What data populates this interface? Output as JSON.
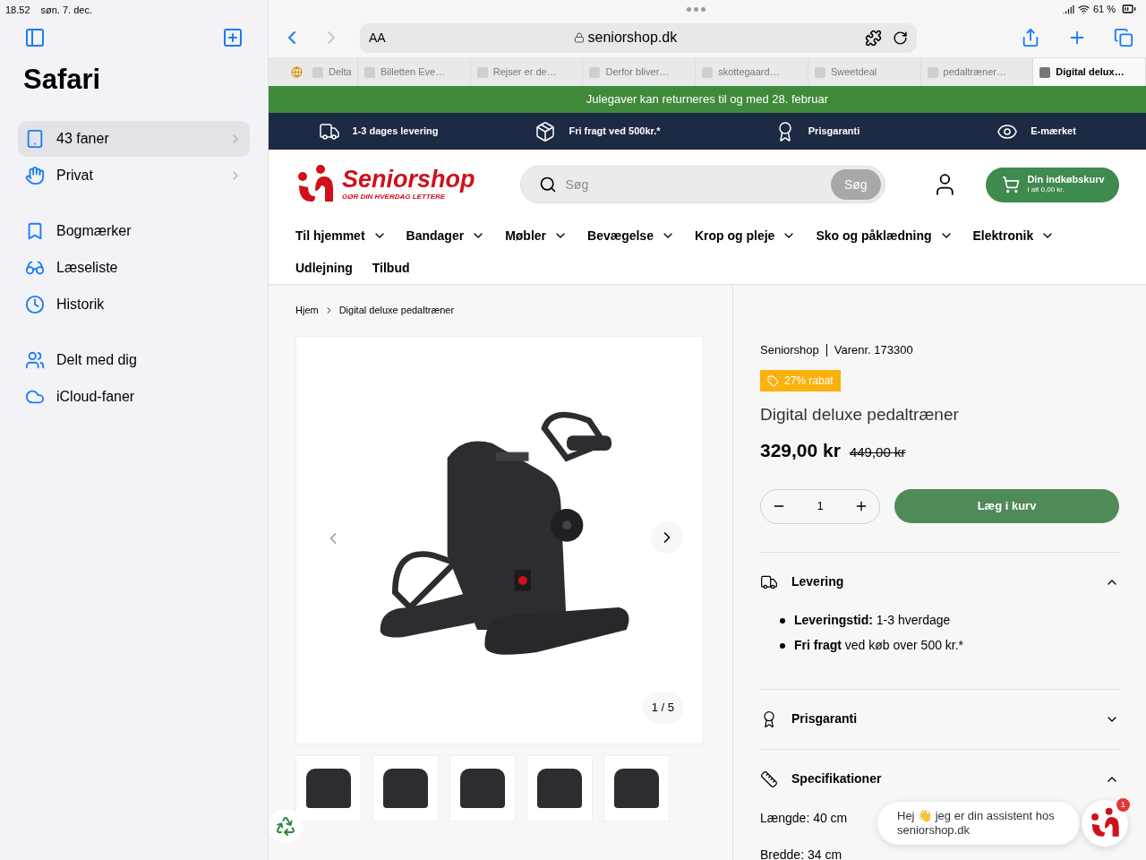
{
  "status_bar": {
    "time": "18.52",
    "date": "søn. 7. dec.",
    "battery": "61 %"
  },
  "sidebar": {
    "title": "Safari",
    "groups": [
      [
        {
          "label": "43 faner",
          "selected": true,
          "kind": "expandable"
        },
        {
          "label": "Privat",
          "selected": false,
          "kind": "expandable"
        }
      ],
      [
        {
          "label": "Bogmærker",
          "selected": false,
          "kind": "plain"
        },
        {
          "label": "Læseliste",
          "selected": false,
          "kind": "plain"
        },
        {
          "label": "Historik",
          "selected": false,
          "kind": "plain"
        }
      ],
      [
        {
          "label": "Delt med dig",
          "selected": false,
          "kind": "plain"
        },
        {
          "label": "iCloud-faner",
          "selected": false,
          "kind": "plain"
        }
      ]
    ]
  },
  "toolbar": {
    "text_size": "AA",
    "url": "seniorshop.dk"
  },
  "tabs": [
    {
      "label": "Delta",
      "selected": false
    },
    {
      "label": "Billetten Eve…",
      "selected": false
    },
    {
      "label": "Rejser er de…",
      "selected": false
    },
    {
      "label": "Derfor bliver…",
      "selected": false
    },
    {
      "label": "skottegaard…",
      "selected": false
    },
    {
      "label": "Sweetdeal",
      "selected": false
    },
    {
      "label": "pedaltræner…",
      "selected": false
    },
    {
      "label": "Digital delux…",
      "selected": true
    }
  ],
  "site": {
    "banner": "Julegaver kan returneres til og med 28. februar",
    "usps": [
      "1-3 dages levering",
      "Fri fragt ved 500kr.*",
      "Prisgaranti",
      "E-mærket"
    ],
    "logo": {
      "name": "Seniorshop",
      "tagline": "GØR DIN HVERDAG LETTERE"
    },
    "search": {
      "placeholder": "Søg",
      "button": "Søg"
    },
    "cart": {
      "title": "Din indkøbskurv",
      "total": "I alt 0,00 kr."
    },
    "nav": [
      {
        "label": "Til hjemmet",
        "kind": "dropdown"
      },
      {
        "label": "Bandager",
        "kind": "dropdown"
      },
      {
        "label": "Møbler",
        "kind": "dropdown"
      },
      {
        "label": "Bevægelse",
        "kind": "dropdown"
      },
      {
        "label": "Krop og pleje",
        "kind": "dropdown"
      },
      {
        "label": "Sko og påklædning",
        "kind": "dropdown"
      },
      {
        "label": "Elektronik",
        "kind": "dropdown"
      },
      {
        "label": "Udlejning",
        "kind": "link"
      },
      {
        "label": "Tilbud",
        "kind": "link"
      }
    ]
  },
  "breadcrumb": [
    "Hjem",
    "Digital deluxe pedaltræner"
  ],
  "gallery": {
    "counter": "1 / 5"
  },
  "product": {
    "brand": "Seniorshop",
    "sku": "Varenr. 173300",
    "badge": "27% rabat",
    "title": "Digital deluxe pedaltræner",
    "price": "329,00 kr",
    "old_price": "449,00 kr",
    "quantity": "1",
    "add_button": "Læg i kurv"
  },
  "accordion": [
    {
      "title": "Levering",
      "expanded": true,
      "bullets": [
        "**Leveringstid:** 1-3 hverdage",
        "**Fri fragt** ved køb over 500 kr.*"
      ]
    },
    {
      "title": "Prisgaranti",
      "expanded": false
    },
    {
      "title": "Specifikationer",
      "expanded": true,
      "lines": [
        "Længde: 40 cm",
        "Bredde: 34 cm"
      ]
    }
  ],
  "chat": {
    "message": "Hej 👋 jeg er din assistent hos seniorshop.dk",
    "badge": "1"
  }
}
